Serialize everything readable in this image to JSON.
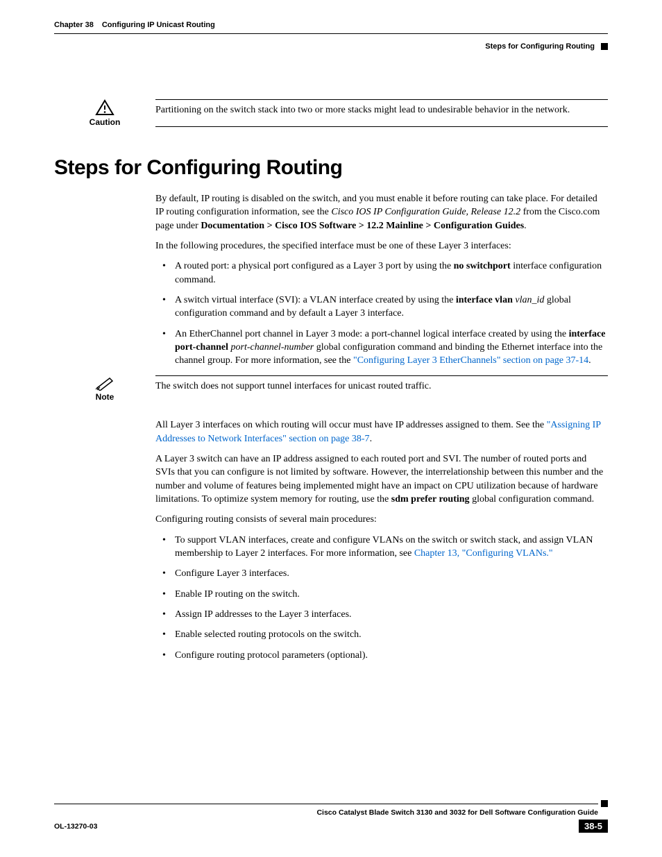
{
  "header": {
    "chapter_label": "Chapter 38",
    "chapter_title": "Configuring IP Unicast Routing",
    "section_running_head": "Steps for Configuring Routing"
  },
  "caution": {
    "label": "Caution",
    "text": "Partitioning on the switch stack into two or more stacks might lead to undesirable behavior in the network."
  },
  "section_heading": "Steps for Configuring Routing",
  "para1_a": "By default, IP routing is disabled on the switch, and you must enable it before routing can take place. For detailed IP routing configuration information, see the ",
  "para1_em": "Cisco IOS IP Configuration Guide, Release 12.2",
  "para1_b": " from the Cisco.com page under ",
  "para1_bold": "Documentation > Cisco IOS Software > 12.2 Mainline > Configuration Guides",
  "para1_c": ".",
  "para2": "In the following procedures, the specified interface must be one of these Layer 3 interfaces:",
  "bullets1": {
    "b1_a": "A routed port: a physical port configured as a Layer 3 port by using the ",
    "b1_bold": "no switchport",
    "b1_b": " interface configuration command.",
    "b2_a": "A switch virtual interface (SVI): a VLAN interface created by using the ",
    "b2_bold": "interface vlan",
    "b2_b": " ",
    "b2_em": "vlan_id",
    "b2_c": " global configuration command and by default a Layer 3 interface.",
    "b3_a": "An EtherChannel port channel in Layer 3 mode: a port-channel logical interface created by using the ",
    "b3_bold": "interface port-channel",
    "b3_b": " ",
    "b3_em": "port-channel-number",
    "b3_c": " global configuration command and binding the Ethernet interface into the channel group. For more information, see the ",
    "b3_link": "\"Configuring Layer 3 EtherChannels\" section on page 37-14",
    "b3_d": "."
  },
  "note": {
    "label": "Note",
    "text": "The switch does not support tunnel interfaces for unicast routed traffic."
  },
  "para3_a": "All Layer 3 interfaces on which routing will occur must have IP addresses assigned to them. See the ",
  "para3_link": "\"Assigning IP Addresses to Network Interfaces\" section on page 38-7",
  "para3_b": ".",
  "para4_a": "A Layer 3 switch can have an IP address assigned to each routed port and SVI. The number of routed ports and SVIs that you can configure is not limited by software. However, the interrelationship between this number and the number and volume of features being implemented might have an impact on CPU utilization because of hardware limitations. To optimize system memory for routing, use the ",
  "para4_bold": "sdm prefer routing",
  "para4_b": " global configuration command.",
  "para5": "Configuring routing consists of several main procedures:",
  "bullets2": {
    "b1_a": "To support VLAN interfaces, create and configure VLANs on the switch or switch stack, and assign VLAN membership to Layer 2 interfaces. For more information, see ",
    "b1_link": "Chapter 13, \"Configuring VLANs.\"",
    "b2": "Configure Layer 3 interfaces.",
    "b3": "Enable IP routing on the switch.",
    "b4": "Assign IP addresses to the Layer 3 interfaces.",
    "b5": "Enable selected routing protocols on the switch.",
    "b6": "Configure routing protocol parameters (optional)."
  },
  "footer": {
    "book_title": "Cisco Catalyst Blade Switch 3130 and 3032 for Dell Software Configuration Guide",
    "doc_id": "OL-13270-03",
    "page_number": "38-5"
  }
}
